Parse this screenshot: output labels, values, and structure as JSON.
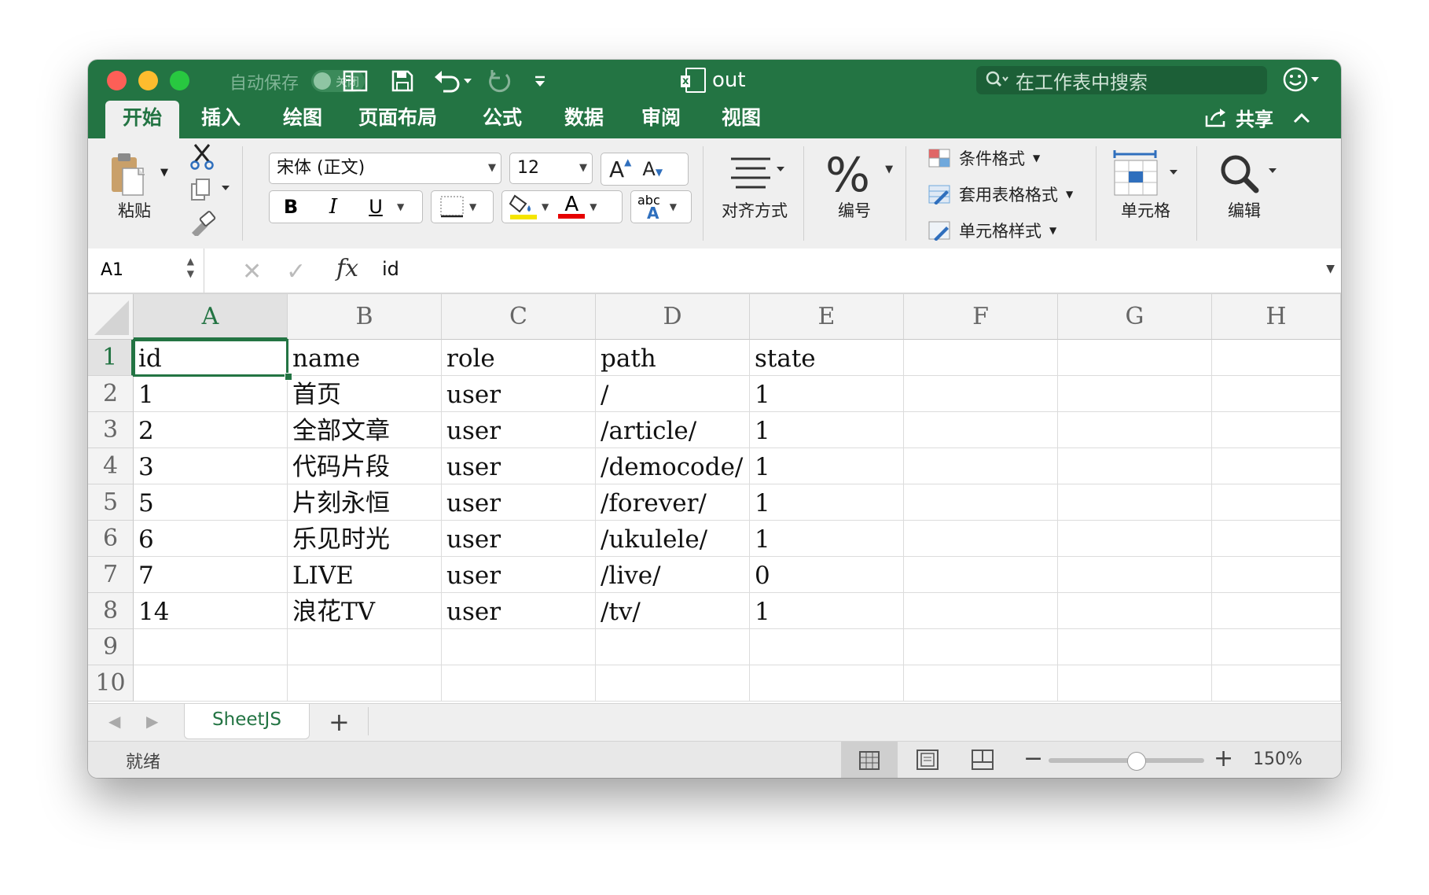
{
  "titlebar": {
    "autosave_label": "自动保存",
    "autosave_state": "关闭",
    "doc_title": "out",
    "doc_badge": "x",
    "search_placeholder": "在工作表中搜索"
  },
  "tabs": [
    {
      "label": "开始",
      "active": true
    },
    {
      "label": "插入"
    },
    {
      "label": "绘图"
    },
    {
      "label": "页面布局"
    },
    {
      "label": "公式"
    },
    {
      "label": "数据"
    },
    {
      "label": "审阅"
    },
    {
      "label": "视图"
    }
  ],
  "share_label": "共享",
  "ribbon": {
    "paste_label": "粘贴",
    "font_name": "宋体 (正文)",
    "font_size": "12",
    "bold": "B",
    "italic": "I",
    "underline": "U",
    "grow_font": "A",
    "shrink_font": "A",
    "font_color_glyph": "A",
    "abc": "abc",
    "abc_a": "A",
    "align_label": "对齐方式",
    "number_label": "编号",
    "number_glyph": "%",
    "conditional_format": "条件格式",
    "table_format": "套用表格格式",
    "cell_style": "单元格样式",
    "cells_label": "单元格",
    "edit_label": "编辑",
    "highlight_color": "#f5e500",
    "font_color": "#e60000"
  },
  "formula_bar": {
    "name_box": "A1",
    "fx": "fx",
    "formula": "id"
  },
  "grid": {
    "columns": [
      "A",
      "B",
      "C",
      "D",
      "E",
      "F",
      "G",
      "H"
    ],
    "rows": [
      "1",
      "2",
      "3",
      "4",
      "5",
      "6",
      "7",
      "8",
      "9",
      "10"
    ],
    "cells": [
      [
        "id",
        "name",
        "role",
        "path",
        "state"
      ],
      [
        "1",
        "首页",
        "user",
        "/",
        "1"
      ],
      [
        "2",
        "全部文章",
        "user",
        "/article/",
        "1"
      ],
      [
        "3",
        "代码片段",
        "user",
        "/democode/",
        "1"
      ],
      [
        "5",
        "片刻永恒",
        "user",
        "/forever/",
        "1"
      ],
      [
        "6",
        "乐见时光",
        "user",
        "/ukulele/",
        "1"
      ],
      [
        "7",
        "LIVE",
        "user",
        "/live/",
        "0"
      ],
      [
        "14",
        "浪花TV",
        "user",
        "/tv/",
        "1"
      ],
      [
        "",
        "",
        "",
        "",
        ""
      ],
      [
        "",
        "",
        "",
        "",
        ""
      ]
    ]
  },
  "sheets": {
    "active": "SheetJS",
    "add": "+"
  },
  "status": {
    "ready": "就绪",
    "zoom": "150%"
  },
  "accent": "#237443"
}
